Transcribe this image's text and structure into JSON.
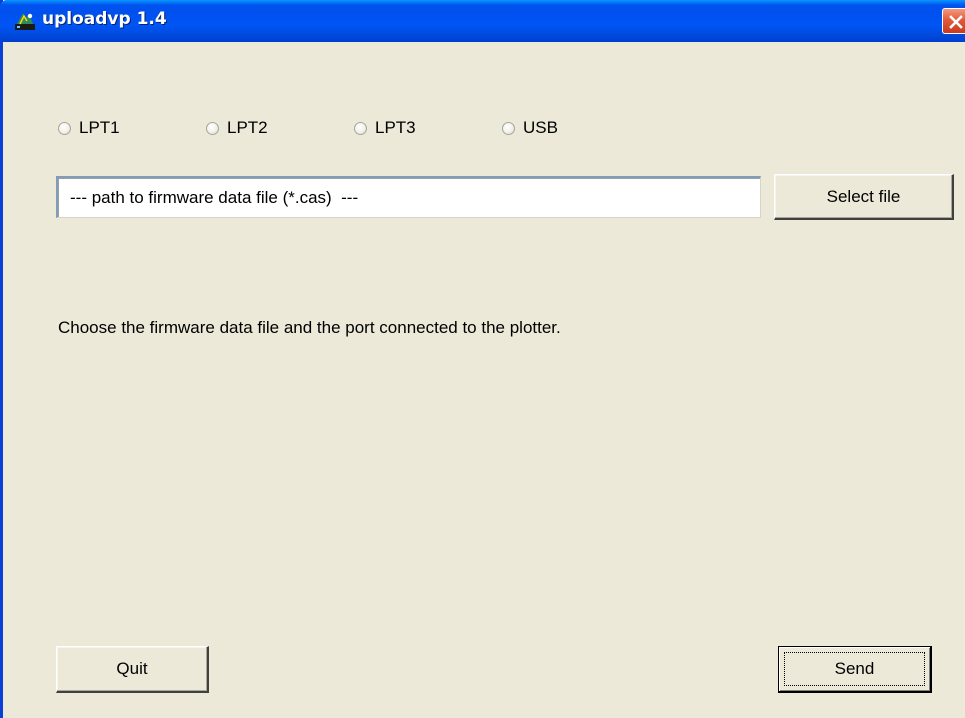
{
  "window": {
    "title": "uploadvp 1.4",
    "app_icon": "plotter-app-icon",
    "close_icon": "close-icon"
  },
  "ports": {
    "options": [
      {
        "label": "LPT1",
        "selected": false
      },
      {
        "label": "LPT2",
        "selected": false
      },
      {
        "label": "LPT3",
        "selected": false
      },
      {
        "label": "USB",
        "selected": false
      }
    ]
  },
  "file": {
    "path_value": "--- path to firmware data file (*.cas)  ---",
    "select_label": "Select file"
  },
  "status": {
    "message": "Choose the firmware data file and the port connected to the plotter."
  },
  "footer": {
    "quit_label": "Quit",
    "send_label": "Send"
  },
  "colors": {
    "titlebar": "#0054E3",
    "window_bg": "#ECE9D8",
    "close_button": "#E25A3A"
  }
}
